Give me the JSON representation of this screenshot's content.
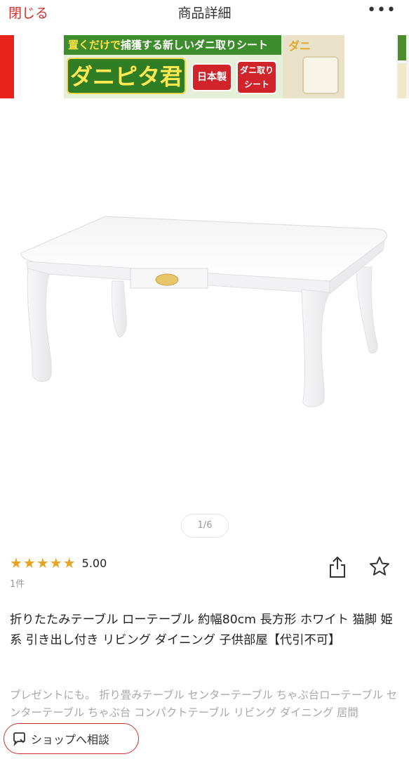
{
  "header": {
    "close_label": "閉じる",
    "title": "商品詳細",
    "more_label": "•••"
  },
  "banner": {
    "tagline_prefix": "置くだけで",
    "tagline": "捕獲する新しいダニ取りシート",
    "brand": "ダニピタ君",
    "badge_made_in": "日本製",
    "badge_sheet_line1": "ダニ取り",
    "badge_sheet_line2": "シート",
    "photo_tag": "ダニ"
  },
  "gallery": {
    "current": "1",
    "separator": "/",
    "total": "6"
  },
  "rating": {
    "stars": "★★★★★",
    "value": "5.00",
    "count": "1件",
    "star_color": "#e8a323"
  },
  "icons": {
    "share": "share-icon",
    "favorite": "star-outline-icon",
    "chat": "chat-bubble-icon"
  },
  "product": {
    "title": "折りたたみテーブル ローテーブル 約幅80cm 長方形 ホワイト 猫脚 姫系 引き出し付き リビング ダイニング 子供部屋【代引不可】",
    "description": "プレゼントにも。 折り畳みテーブル センターテーブル ちゃぶ台ローテーブル センターテーブル ちゃぶ台 コンパクトテーブル リビング ダイニング 居間"
  },
  "shop_contact": {
    "label": "ショップへ相談"
  },
  "colors": {
    "accent": "#d0312d",
    "banner_green": "#3d8c2d",
    "muted_text": "#a8a8a8"
  }
}
